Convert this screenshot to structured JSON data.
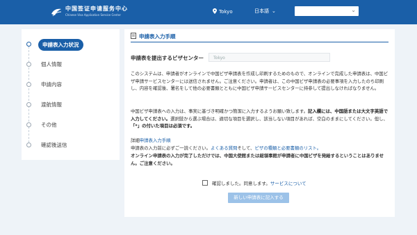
{
  "header": {
    "logo_title": "中国签证申请服务中心",
    "logo_subtitle": "Chinese Visa Application Service Center",
    "location": "Tokyo",
    "language": "日本語",
    "login_value": ""
  },
  "sidebar": {
    "items": [
      {
        "label": "申請表入力状況",
        "active": true
      },
      {
        "label": "個人情報"
      },
      {
        "label": "申請内容"
      },
      {
        "label": "渡航情報"
      },
      {
        "label": "その他"
      },
      {
        "label": "確認後送信"
      }
    ]
  },
  "main": {
    "heading": "申請表入力手順",
    "center_label": "申請表を提出するビザセンター",
    "center_value": "Tokyo",
    "p1": "このシステムは、申請者がオンラインで中国ビザ申請表を作成し印刷するためのもので、オンラインで完成した申請表は、中国ビザ申請サービスセンターには送信されません。ご注意ください。申請者は、この中国ビザ申請表の必要事項を入力したのち印刷し、内容を確認後、署名をして他の必要書類とともに中国ビザ申請サービスセンターに持参して提出しなければなりません。",
    "p2_a": "中国ビザ申請表への入力は、事実に基づき明確かつ簡潔に入力するようお願い致します。",
    "p2_b": "記入欄には、中国語または大文字英語で入力してください。",
    "p2_c": "選択肢から選ぶ場合は、適切な項目を選択し、該当しない項目があれば、空白のままにしてください。但し、",
    "p2_d": "「*」の付いた項目は必須です。",
    "detail_prefix": "詳細",
    "detail_link": "申請表入力手順",
    "p3_a": "申請表の入力前に必ずご一読ください。",
    "p3_link1": "よくある質問",
    "p3_b": "そして、",
    "p3_link2": "ビザの種類と必要書類のリスト。",
    "p4": "オンライン申請表の入力が完了しただけでは、中国大使館または総領事館が申請者に中国ビザを発給するということはありません。ご注意ください。",
    "agree_text": "確認しました。同意します。",
    "agree_link": "サービスについて",
    "agree_checked": false,
    "submit_label": "新しい申請表に記入する"
  },
  "colors": {
    "brand": "#1a5fa8",
    "background": "#eef3f8",
    "button_disabled": "#9cc2e8"
  }
}
